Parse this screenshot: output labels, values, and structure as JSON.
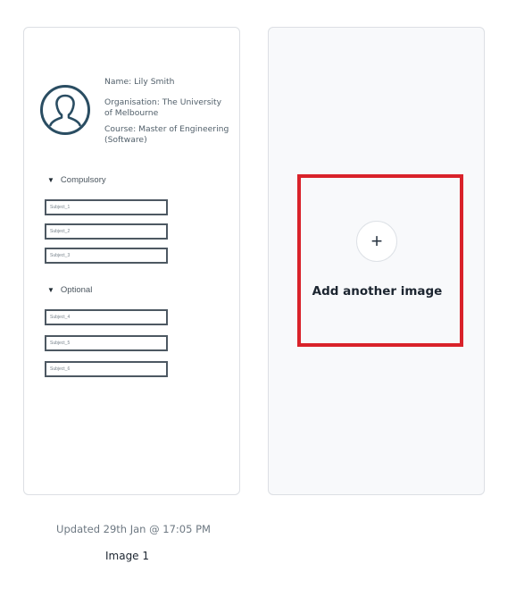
{
  "preview": {
    "profile": {
      "name": "Name: Lily Smith",
      "organisation": "Organisation: The University of Melbourne",
      "course": "Course: Master of Engineering (Software)"
    },
    "compulsory": {
      "label": "Compulsory",
      "subjects": [
        "Subject_1",
        "Subject_2",
        "Subject_3"
      ]
    },
    "optional": {
      "label": "Optional",
      "subjects": [
        "Subject_4",
        "Subject_5",
        "Subject_6"
      ]
    }
  },
  "add_card": {
    "icon": "plus-icon",
    "label": "Add another image",
    "highlight_color": "#d9222a"
  },
  "footer": {
    "updated": "Updated 29th Jan @ 17:05 PM",
    "image_label": "Image 1"
  }
}
